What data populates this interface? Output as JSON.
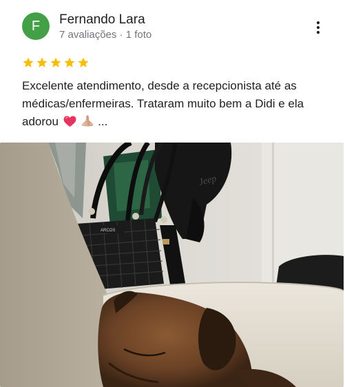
{
  "review": {
    "author": {
      "initial": "F",
      "name": "Fernando Lara",
      "meta": "7 avaliações · 1 foto",
      "avatar_color": "#43a047"
    },
    "rating": 5,
    "star_color": "#fbbc04",
    "text_main": "Excelente atendimento, desde a recepcionista até as médicas/enfermeiras. Trataram muito bem a Didi e ela adorou",
    "text_ellipsis": "...",
    "emojis": [
      "red-heart-emoji",
      "folded-hands-emoji"
    ],
    "more_icon": "more-vert-icon"
  },
  "photo": {
    "description": "",
    "bag_brand": "ARCOS",
    "cap_brand": "Jeep"
  }
}
